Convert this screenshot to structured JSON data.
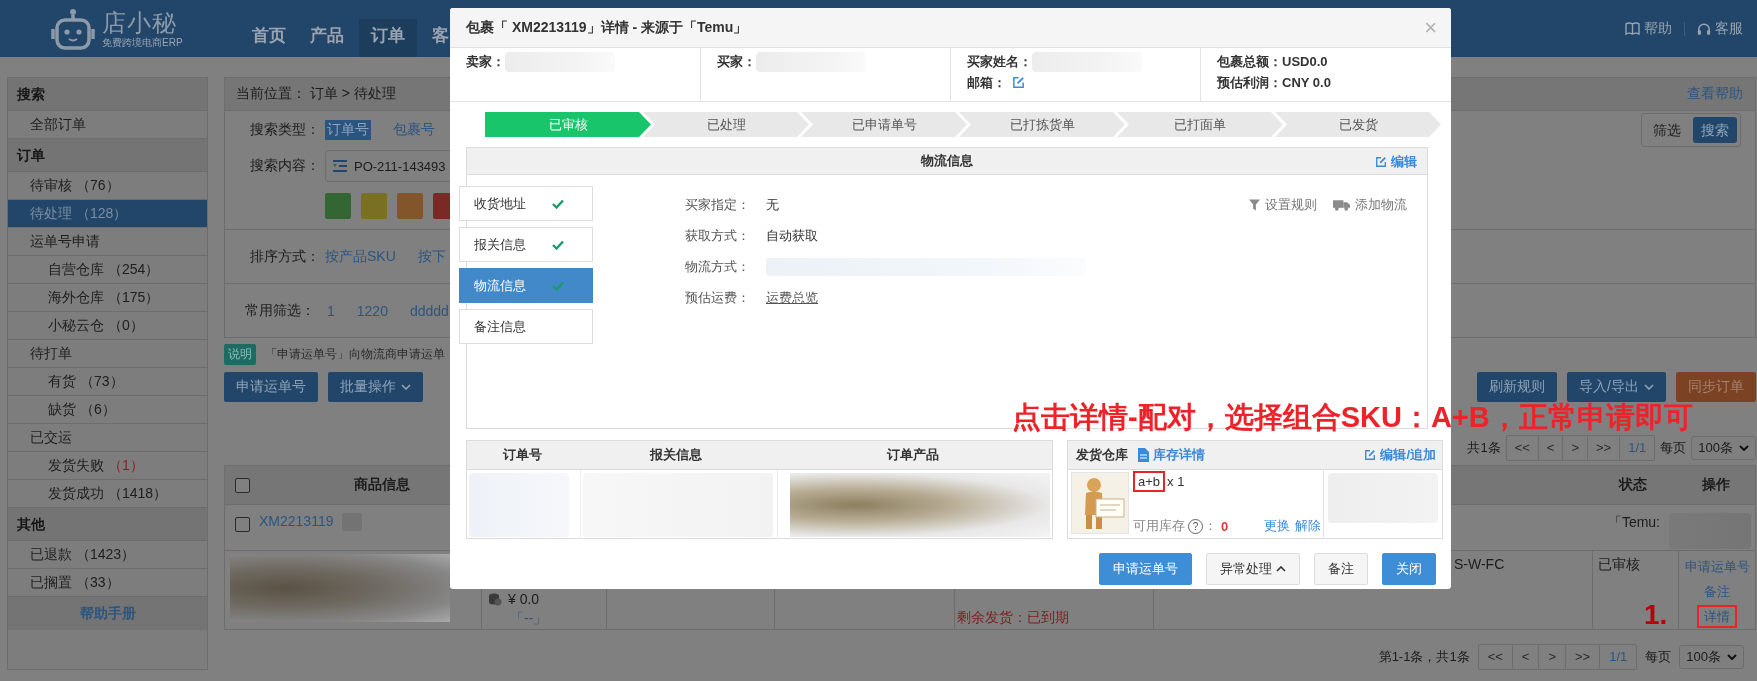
{
  "header": {
    "logo": {
      "name": "店小秘",
      "tagline": "免费跨境电商ERP"
    },
    "nav": [
      {
        "label": "首页",
        "selected": false
      },
      {
        "label": "产品",
        "selected": false
      },
      {
        "label": "订单",
        "selected": true
      },
      {
        "label": "客",
        "selected": false
      }
    ],
    "links": [
      {
        "label": "帮助",
        "kind": "book"
      },
      {
        "label": "客服",
        "kind": "headset"
      }
    ]
  },
  "sidebar": {
    "sections": [
      {
        "title": "搜索",
        "items": [
          {
            "label": "全部订单",
            "selected": false
          }
        ]
      },
      {
        "title": "订单",
        "items": [
          {
            "label": "待审核",
            "count": "（76）",
            "alert": false,
            "selected": false
          },
          {
            "label": "待处理",
            "count": "（128）",
            "alert": false,
            "selected": true
          },
          {
            "label": "运单号申请",
            "selected": false,
            "children": [
              {
                "label": "自营仓库",
                "count": "（254）",
                "alert": false,
                "selected": false
              },
              {
                "label": "海外仓库",
                "count": "（175）",
                "alert": false,
                "selected": false
              },
              {
                "label": "小秘云仓",
                "count": "（0）",
                "alert": false,
                "selected": false
              }
            ]
          },
          {
            "label": "待打单",
            "selected": false,
            "children": [
              {
                "label": "有货",
                "count": "（73）",
                "alert": false,
                "selected": false
              },
              {
                "label": "缺货",
                "count": "（6）",
                "alert": false,
                "selected": false
              }
            ]
          },
          {
            "label": "已交运",
            "selected": false,
            "children": [
              {
                "label": "发货失败",
                "count": "（1）",
                "alert": true,
                "selected": false
              },
              {
                "label": "发货成功",
                "count": "（1418）",
                "alert": false,
                "selected": false
              }
            ]
          }
        ]
      },
      {
        "title": "其他",
        "items": [
          {
            "label": "已退款",
            "count": "（1423）",
            "alert": false,
            "selected": false
          },
          {
            "label": "已搁置",
            "count": "（33）",
            "alert": false,
            "selected": false
          }
        ]
      }
    ],
    "footer": "帮助手册"
  },
  "main": {
    "breadcrumb": "当前位置：  订单 > 待处理",
    "help": "查看帮助",
    "search": {
      "type_label": "搜索类型：",
      "types": [
        {
          "label": "订单号",
          "selected": true
        },
        {
          "label": "包裹号",
          "selected": false
        }
      ],
      "content_label": "搜索内容：",
      "content_value": "PO-211-143493",
      "tags": [
        {
          "color": "#336633"
        },
        {
          "color": "#7a7024"
        },
        {
          "color": "#82552a"
        },
        {
          "color": "#7a2a26"
        }
      ],
      "modes": [
        {
          "label": "筛选",
          "selected": false
        },
        {
          "label": "搜索",
          "selected": true
        }
      ]
    },
    "sort": {
      "label": "排序方式：",
      "options": [
        "按产品SKU",
        "按下"
      ]
    },
    "filters": {
      "label": "常用筛选：",
      "options": [
        "1",
        "1220",
        "ddddd"
      ]
    },
    "note": {
      "tag": "说明",
      "text": "「申请运单号」向物流商申请运单"
    },
    "actions_left": [
      {
        "label": "申请运单号",
        "kind": "primary"
      },
      {
        "label": "批量操作",
        "kind": "dropdown"
      }
    ],
    "actions_right": [
      {
        "label": "刷新规则",
        "kind": "primary"
      },
      {
        "label": "导入/导出",
        "kind": "dropdown"
      },
      {
        "label": "同步订单",
        "kind": "warning"
      }
    ],
    "pager_top": {
      "summary": "共1条",
      "buttons": [
        "<<",
        "<",
        ">",
        ">>",
        "1/1"
      ],
      "per_page_label": "每页",
      "per_page": "100条"
    },
    "table": {
      "columns": [
        {
          "label": "商品信息"
        },
        {
          "label": "状态"
        },
        {
          "label": "操作"
        }
      ],
      "all_checked": false,
      "order": {
        "checked": false,
        "number": "XM2213119",
        "platform": "「Temu:"
      },
      "item": {
        "price": "¥ 0.0",
        "code": "「--」",
        "remaining": "剩余发货：已到期",
        "sku": "S-W-FC",
        "status": "已审核",
        "ops": [
          {
            "label": "申请运单号",
            "highlighted": false
          },
          {
            "label": "备注",
            "highlighted": false
          },
          {
            "label": "详情",
            "highlighted": true
          }
        ]
      }
    },
    "pager_bottom": {
      "summary": "第1-1条，共1条",
      "buttons": [
        "<<",
        "<",
        ">",
        ">>",
        "1/1"
      ],
      "per_page_label": "每页",
      "per_page": "100条"
    }
  },
  "annotation": {
    "text": "点击详情-配对，选择组合SKU：A+B，正常申请即可",
    "step": "1."
  },
  "modal": {
    "title": "包裹「 XM2213119」详情 - 来源于「Temu」",
    "close": "×",
    "info": [
      {
        "fields": [
          {
            "label": "卖家：",
            "kind": "blurred"
          }
        ]
      },
      {
        "fields": [
          {
            "label": "买家：",
            "kind": "blurred"
          }
        ]
      },
      {
        "fields": [
          {
            "label": "买家姓名：",
            "kind": "blurred"
          },
          {
            "label": "邮箱：",
            "kind": "edit"
          }
        ]
      },
      {
        "fields": [
          {
            "label": "包裹总额：",
            "kind": "text",
            "value": "USD0.0"
          },
          {
            "label": "预估利润：",
            "kind": "text",
            "value": "CNY 0.0"
          }
        ]
      }
    ],
    "steps": [
      {
        "label": "已审核",
        "done": true
      },
      {
        "label": "已处理",
        "done": false
      },
      {
        "label": "已申请单号",
        "done": false
      },
      {
        "label": "已打拣货单",
        "done": false
      },
      {
        "label": "已打面单",
        "done": false
      },
      {
        "label": "已发货",
        "done": false
      }
    ],
    "panel": {
      "title": "物流信息",
      "edit": "编辑",
      "tabs": [
        {
          "label": "收货地址",
          "checked": true,
          "selected": false
        },
        {
          "label": "报关信息",
          "checked": true,
          "selected": false
        },
        {
          "label": "物流信息",
          "checked": true,
          "selected": true
        },
        {
          "label": "备注信息",
          "checked": false,
          "selected": false
        }
      ],
      "fields": [
        {
          "label": "买家指定：",
          "kind": "text",
          "value": "无"
        },
        {
          "label": "获取方式：",
          "kind": "text",
          "value": "自动获取"
        },
        {
          "label": "物流方式：",
          "kind": "blurred"
        },
        {
          "label": "预估运费：",
          "kind": "link",
          "value": "运费总览"
        }
      ],
      "tools": [
        {
          "label": "设置规则",
          "kind": "filter"
        },
        {
          "label": "添加物流",
          "kind": "truck"
        }
      ]
    },
    "orders": {
      "columns": [
        "订单号",
        "报关信息",
        "订单产品"
      ]
    },
    "warehouse": {
      "title": "发货仓库",
      "stock_link": "库存详情",
      "edit": "编辑/追加",
      "sku": "a+b",
      "sku_flagged": true,
      "qty": "x 1",
      "stock_label": "可用库存",
      "help": "?",
      "sep": "：",
      "stock": "0",
      "actions": [
        "更换",
        "解除"
      ]
    },
    "buttons": [
      {
        "label": "申请运单号",
        "kind": "primary"
      },
      {
        "label": "异常处理",
        "kind": "dropup"
      },
      {
        "label": "备注",
        "kind": "default"
      },
      {
        "label": "关闭",
        "kind": "primary"
      }
    ]
  }
}
